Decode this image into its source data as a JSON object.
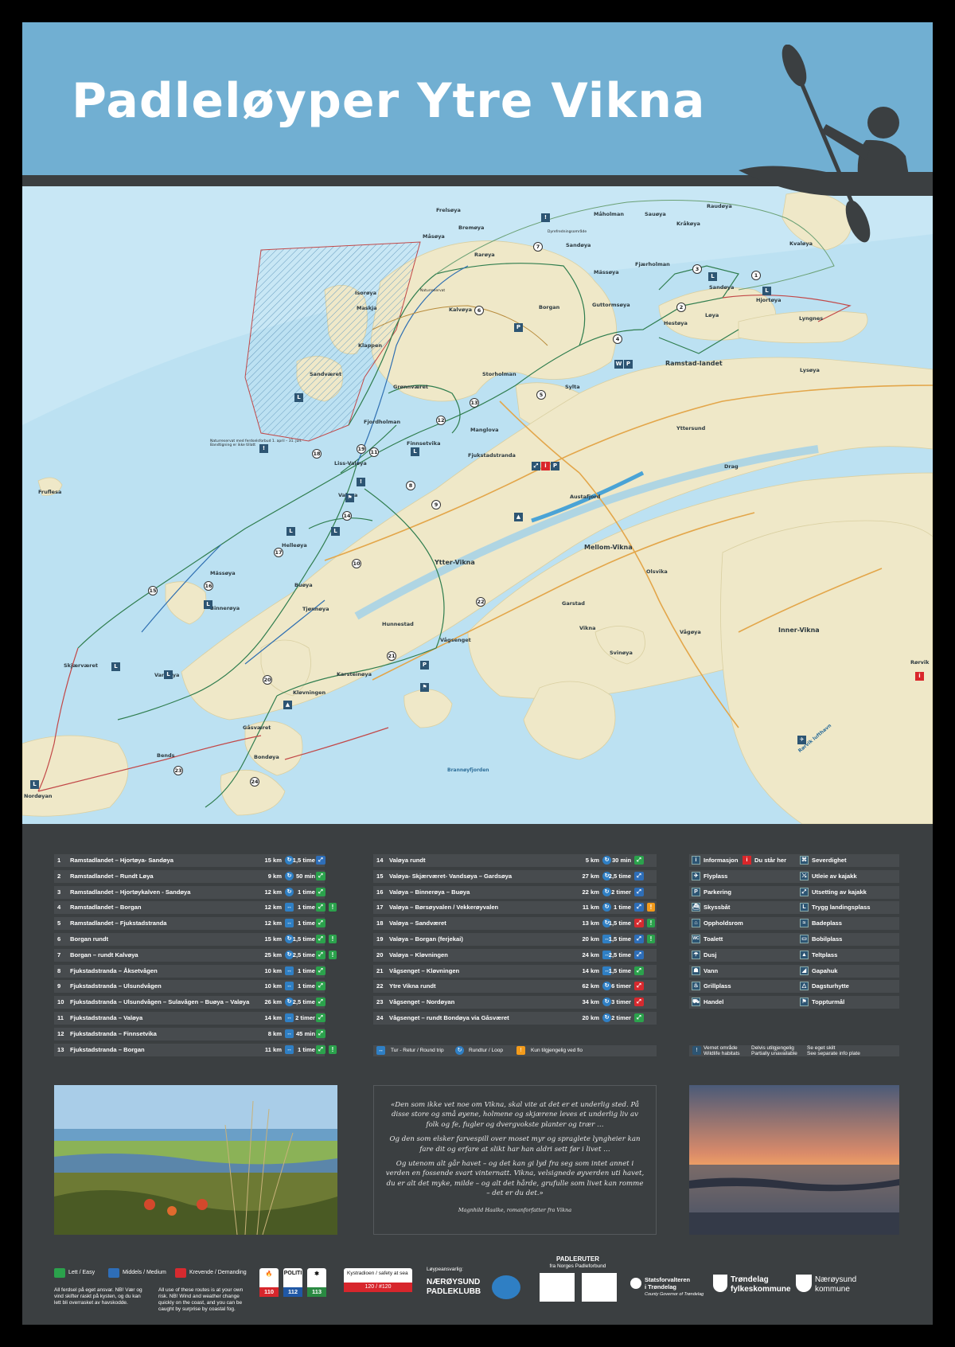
{
  "title": "Padleløyper Ytre Vikna",
  "map": {
    "places": {
      "frelsoya": "Frelsøya",
      "maholman": "Måholman",
      "sauoya": "Sauøya",
      "raudoya": "Raudøya",
      "krakoya": "Kråkøya",
      "kvaloya": "Kvaløya",
      "masoya_n": "Måsøya",
      "bremoya": "Bremøya",
      "durokvelse": "Dyrefredningsområde",
      "raroya": "Rarøya",
      "sandoya_n": "Sandøya",
      "massoya": "Mässøya",
      "fjaerholman": "Fjærholman",
      "isoroya": "Isorøya",
      "maskja": "Maskja",
      "naturreservat": "Naturreservat",
      "kalvoya": "Kalvøya",
      "borgan": "Borgan",
      "guttormsoya": "Guttormsøya",
      "sandoya_e": "Sandøya",
      "hjortoya": "Hjortøya",
      "loya": "Løya",
      "hestoya": "Hestøya",
      "lyngnes": "Lyngnes",
      "klappen": "Klappen",
      "sandvaeret": "Sandværet",
      "gronnvaeret": "Grønnværet",
      "storholman": "Storholman",
      "ramstadlandet": "Ramstad-landet",
      "lysoya": "Lysøya",
      "sylta": "Sylta",
      "fjordholman": "Fjordholman",
      "manglova": "Manglova",
      "finnsetvika": "Finnsetvika",
      "fjukstadstranda": "Fjukstadstranda",
      "yttersund": "Yttersund",
      "drag": "Drag",
      "lissvaloya": "Liss-Valøya",
      "valoya": "Valøya",
      "austafjord": "Austafjord",
      "fruflesa": "Fruflesa",
      "helleoya": "Helleøya",
      "mellomvikna": "Mellom-Vikna",
      "yttervikna": "Ytter-Vikna",
      "olsvika": "Olsvika",
      "massoya_w": "Mässøya",
      "buoya": "Buøya",
      "binneroya": "Binnerøya",
      "tjonnoya": "Tjønnøya",
      "hunnestad": "Hunnestad",
      "garstad": "Garstad",
      "vikna": "Vikna",
      "innervikna": "Inner-Vikna",
      "vagoya": "Vågøya",
      "svinoya": "Svinøya",
      "vagsenget": "Vågsenget",
      "skjaervaeret": "Skjærværet",
      "vannoya": "Vannøya",
      "klovningen": "Kløvningen",
      "karsteinoya": "Karsteinøya",
      "rorvik": "Rørvik",
      "gasvaeret": "Gåsværet",
      "bends": "Bends",
      "bondoya": "Bondøya",
      "brannoyfjorden": "Brannøyfjorden",
      "nordoyan": "Nordøyan",
      "rorvik_lufthavn": "Rørvik lufthavn"
    },
    "notes": {
      "naturreservat_note": "Naturreservat med ferdselsforbud 1. april – 31. juli. Bandtigning er ikke tillatt"
    }
  },
  "routes_left": [
    {
      "no": "1",
      "name": "Ramstadlandet – Hjortøya- Sandøya",
      "dist": "15 km",
      "type": "loop",
      "time": "1,5 time",
      "diff": "medium",
      "warn": ""
    },
    {
      "no": "2",
      "name": "Ramstadlandet – Rundt Løya",
      "dist": "9 km",
      "type": "loop",
      "time": "50 min",
      "diff": "easy",
      "warn": ""
    },
    {
      "no": "3",
      "name": "Ramstadlandet – Hjortøykalven - Sandøya",
      "dist": "12 km",
      "type": "loop",
      "time": "1 time",
      "diff": "easy",
      "warn": ""
    },
    {
      "no": "4",
      "name": "Ramstadlandet – Borgan",
      "dist": "12 km",
      "type": "return",
      "time": "1 time",
      "diff": "easy",
      "warn": "!"
    },
    {
      "no": "5",
      "name": "Ramstadlandet – Fjukstadstranda",
      "dist": "12 km",
      "type": "return",
      "time": "1 time",
      "diff": "easy",
      "warn": ""
    },
    {
      "no": "6",
      "name": "Borgan rundt",
      "dist": "15 km",
      "type": "loop",
      "time": "1,5 time",
      "diff": "easy",
      "warn": "!"
    },
    {
      "no": "7",
      "name": "Borgan – rundt Kalvøya",
      "dist": "25 km",
      "type": "loop",
      "time": "2,5 time",
      "diff": "easy",
      "warn": "!"
    },
    {
      "no": "8",
      "name": "Fjukstadstranda – Åksetvågen",
      "dist": "10 km",
      "type": "return",
      "time": "1 time",
      "diff": "easy",
      "warn": ""
    },
    {
      "no": "9",
      "name": "Fjukstadstranda – Ulsundvågen",
      "dist": "10 km",
      "type": "return",
      "time": "1 time",
      "diff": "easy",
      "warn": ""
    },
    {
      "no": "10",
      "name": "Fjukstadstranda – Ulsundvågen – Sulavågen – Buøya – Valøya",
      "dist": "26 km",
      "type": "loop",
      "time": "2,5 time",
      "diff": "easy",
      "warn": ""
    },
    {
      "no": "11",
      "name": "Fjukstadstranda – Valøya",
      "dist": "14 km",
      "type": "return",
      "time": "2 timer",
      "diff": "easy",
      "warn": ""
    },
    {
      "no": "12",
      "name": "Fjukstadstranda – Finnsetvika",
      "dist": "8 km",
      "type": "return",
      "time": "45 min",
      "diff": "easy",
      "warn": ""
    },
    {
      "no": "13",
      "name": "Fjukstadstranda – Borgan",
      "dist": "11 km",
      "type": "return",
      "time": "1 time",
      "diff": "easy",
      "warn": "!"
    }
  ],
  "routes_right": [
    {
      "no": "14",
      "name": "Valøya rundt",
      "dist": "5 km",
      "type": "loop",
      "time": "30 min",
      "diff": "easy",
      "warn": ""
    },
    {
      "no": "15",
      "name": "Valøya- Skjærværet- Vandsøya – Gardsøya",
      "dist": "27 km",
      "type": "loop",
      "time": "2,5 time",
      "diff": "medium",
      "warn": ""
    },
    {
      "no": "16",
      "name": "Valøya – Binnerøya – Buøya",
      "dist": "22 km",
      "type": "loop",
      "time": "2 timer",
      "diff": "medium",
      "warn": ""
    },
    {
      "no": "17",
      "name": "Valøya – Børsøyvalen / Vekkerøyvalen",
      "dist": "11 km",
      "type": "loop",
      "time": "1 time",
      "diff": "medium",
      "warn": "tri"
    },
    {
      "no": "18",
      "name": "Valøya – Sandværet",
      "dist": "13 km",
      "type": "loop",
      "time": "1,5 time",
      "diff": "hard",
      "warn": "!"
    },
    {
      "no": "19",
      "name": "Valøya – Borgan (ferjekai)",
      "dist": "20 km",
      "type": "return",
      "time": "1,5 time",
      "diff": "medium",
      "warn": "!"
    },
    {
      "no": "20",
      "name": "Valøya – Kløvningen",
      "dist": "24 km",
      "type": "return",
      "time": "2,5 time",
      "diff": "medium",
      "warn": ""
    },
    {
      "no": "21",
      "name": "Vågsenget – Kløvningen",
      "dist": "14 km",
      "type": "return",
      "time": "1,5 time",
      "diff": "easy",
      "warn": ""
    },
    {
      "no": "22",
      "name": "Ytre Vikna rundt",
      "dist": "62 km",
      "type": "loop",
      "time": "6 timer",
      "diff": "hard",
      "warn": ""
    },
    {
      "no": "23",
      "name": "Vågsenget – Nordøyan",
      "dist": "34 km",
      "type": "loop",
      "time": "3 timer",
      "diff": "hard",
      "warn": ""
    },
    {
      "no": "24",
      "name": "Vågsenget – rundt Bondøya via Gåsværet",
      "dist": "20 km",
      "type": "loop",
      "time": "2 timer",
      "diff": "easy",
      "warn": ""
    }
  ],
  "symbols": [
    {
      "icon": "info-icon",
      "glyph": "i",
      "label": "Informasjon",
      "icon2": "you-are-here-icon",
      "glyph2": "i",
      "red2": true,
      "label2": "Du står her",
      "icon3": "sight-icon",
      "glyph3": "⌘",
      "label3": "Severdighet"
    },
    {
      "icon": "airport-icon",
      "glyph": "✈",
      "label": "Flyplass",
      "icon3": "kayak-rental-icon",
      "glyph3": "⤯",
      "label3": "Utleie av kajakk"
    },
    {
      "icon": "parking-icon",
      "glyph": "P",
      "label": "Parkering",
      "icon3": "kayak-launch-icon",
      "glyph3": "⤢",
      "label3": "Utsetting av kajakk"
    },
    {
      "icon": "boat-icon",
      "glyph": "⛴",
      "label": "Skyssbåt",
      "icon3": "landing-icon",
      "glyph3": "L",
      "label3": "Trygg landingsplass"
    },
    {
      "icon": "shelter-icon",
      "glyph": "⌂",
      "label": "Oppholdsrom",
      "icon3": "beach-icon",
      "glyph3": "≈",
      "label3": "Badeplass"
    },
    {
      "icon": "toilet-icon",
      "glyph": "WC",
      "label": "Toalett",
      "icon3": "camper-icon",
      "glyph3": "▭",
      "label3": "Bobilplass"
    },
    {
      "icon": "shower-icon",
      "glyph": "☂",
      "label": "Dusj",
      "icon3": "tent-icon",
      "glyph3": "▲",
      "label3": "Teltplass"
    },
    {
      "icon": "water-icon",
      "glyph": "☗",
      "label": "Vann",
      "icon3": "lean-to-icon",
      "glyph3": "◢",
      "label3": "Gapahuk"
    },
    {
      "icon": "grill-icon",
      "glyph": "♨",
      "label": "Grillplass",
      "icon3": "cabin-icon",
      "glyph3": "△",
      "label3": "Dagsturhytte"
    },
    {
      "icon": "shop-icon",
      "glyph": "⛟",
      "label": "Handel",
      "icon3": "summit-icon",
      "glyph3": "⚑",
      "label3": "Toppturmål"
    }
  ],
  "keys": {
    "return": "Tur - Retur / Round trip",
    "loop": "Rundtur / Loop",
    "tide": "Kun tilgjengelig ved flo",
    "protected_1": "Vernet område",
    "protected_2": "Wildlife habitats",
    "partial_1": "Delvis utilgjengelig",
    "partial_2": "Partially unavailable",
    "seesign_1": "Se eget skilt",
    "seesign_2": "See separate info plate"
  },
  "poem": {
    "p1": "«Den som ikke vet noe om Vikna, skal vite at det er et underlig sted. På disse store og små øyene, holmene og skjærene leves et underlig liv av folk og fe, fugler og dvergvokste planter og trær …",
    "p2": "Og den som elsker farvespill over moset myr og spraglete lyngheier kan fare dit og erfare at slikt har han aldri sett før i livet …",
    "p3": "Og utenom alt går havet – og det kan gi lyd fra seg som intet annet i verden en fossende svart vinternatt. Vikna, velsignede øyverden uti havet, du er alt det myke, milde – og alt det hårde, grufulle som livet kan romme – det er du det.»",
    "author": "Magnhild Haalke, romanforfatter fra Vikna"
  },
  "footer": {
    "easy": "Lett / Easy",
    "medium": "Middels / Medium",
    "hard": "Krevende / Demanding",
    "resp_no": "All ferdsel på eget ansvar. NB! Vær og vind skifter raskt på kysten, og du kan lett bli overrasket av havskodde.",
    "resp_en": "All use of these routes is at your own risk. NB! Wind and weather change quickly on the coast, and you can be caught by surprise by coastal fog.",
    "fire": "110",
    "police_label": "POLITI",
    "police": "112",
    "ambulance": "113",
    "radio_label": "Kystradioen / safety at sea",
    "radio_num": "120   /   #120",
    "responsible": "Løypeansvarlig:",
    "club_1": "NÆRØYSUND",
    "club_2": "PADLEKLUBB",
    "padleruter": "PADLERUTER",
    "fra": "fra Norges Padleforbund",
    "statsf_1": "Statsforvalteren",
    "statsf_2": "i Trøndelag",
    "statsf_3": "County Governor of Trøndelag",
    "trond_1": "Trøndelag",
    "trond_2": "fylkeskommune",
    "naer_1": "Nærøysund",
    "naer_2": "kommune"
  }
}
